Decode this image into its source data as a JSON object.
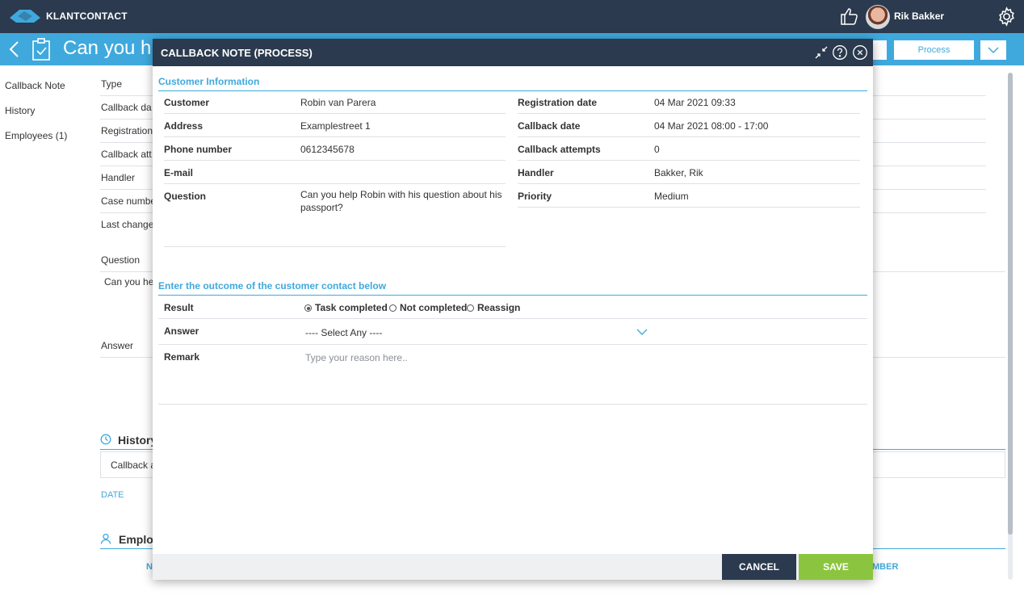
{
  "app": {
    "brand": "KLANTCONTACT",
    "user_name": "Rik Bakker"
  },
  "page": {
    "title": "Can you he",
    "process_label": "Process"
  },
  "left_nav": [
    {
      "label": "Callback Note"
    },
    {
      "label": "History"
    },
    {
      "label": "Employees (1)"
    }
  ],
  "background": {
    "fields": [
      "Type",
      "Callback da",
      "Registration",
      "Callback att",
      "Handler",
      "Case numbe",
      "Last change"
    ],
    "question_label": "Question",
    "question_text": "Can you hel",
    "answer_label": "Answer",
    "history_label": "History",
    "history_box_text": "Callback a",
    "date_col": "DATE",
    "employees_label": "Emplo",
    "col_na": "N",
    "col_mber": "MBER"
  },
  "modal": {
    "title": "CALLBACK NOTE (PROCESS)",
    "customer_info_title": "Customer Information",
    "left_rows": [
      {
        "label": "Customer",
        "value": "Robin van Parera"
      },
      {
        "label": "Address",
        "value": "Examplestreet 1"
      },
      {
        "label": "Phone number",
        "value": "0612345678"
      },
      {
        "label": "E-mail",
        "value": ""
      },
      {
        "label": "Question",
        "value": "Can you help Robin with his question about his passport?"
      }
    ],
    "right_rows": [
      {
        "label": "Registration date",
        "value": "04 Mar 2021 09:33"
      },
      {
        "label": "Callback date",
        "value": "04 Mar 2021 08:00 - 17:00"
      },
      {
        "label": "Callback attempts",
        "value": "0"
      },
      {
        "label": "Handler",
        "value": "Bakker, Rik"
      },
      {
        "label": "Priority",
        "value": "Medium"
      }
    ],
    "outcome_title": "Enter the outcome of the customer contact below",
    "result_label": "Result",
    "result_options": [
      {
        "label": "Task completed",
        "selected": true
      },
      {
        "label": "Not completed",
        "selected": false
      },
      {
        "label": "Reassign",
        "selected": false
      }
    ],
    "answer_label": "Answer",
    "answer_select_value": "---- Select Any ----",
    "remark_label": "Remark",
    "remark_placeholder": "Type your reason here..",
    "cancel_label": "CANCEL",
    "save_label": "SAVE"
  },
  "colors": {
    "navy": "#2b3a4e",
    "accent_blue": "#3fa9dd",
    "save_green": "#8bc53f"
  },
  "icons": [
    "logo-icon",
    "thumbs-up-icon",
    "gear-icon",
    "back-arrow-icon",
    "clipboard-check-icon",
    "minimize-icon",
    "help-icon",
    "close-icon",
    "chevron-down-icon",
    "clock-icon",
    "user-icon"
  ]
}
